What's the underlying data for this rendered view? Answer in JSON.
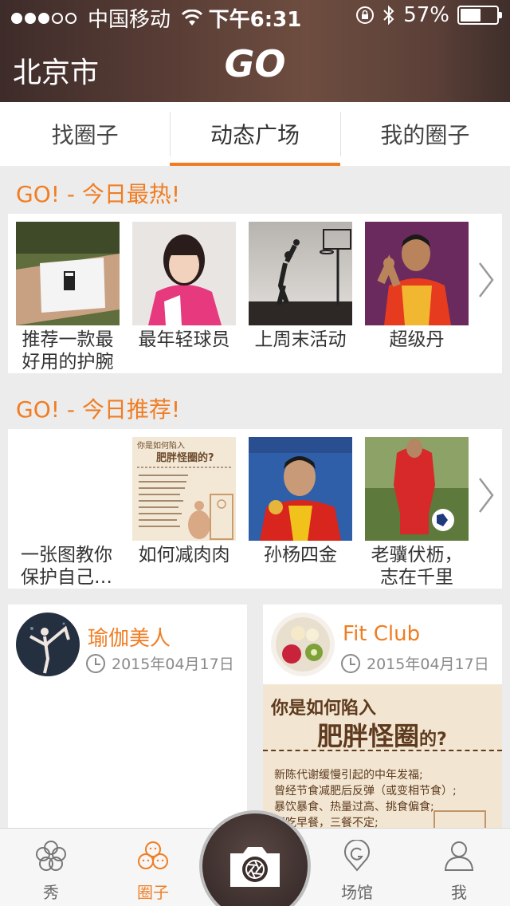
{
  "status_bar": {
    "carrier": "中国移动",
    "time": "下午6:31",
    "battery_percent": "57%",
    "battery_level": 0.57
  },
  "header": {
    "city": "北京市",
    "logo_text": "GO"
  },
  "tabs": [
    {
      "label": "找圈子",
      "active": false
    },
    {
      "label": "动态广场",
      "active": true
    },
    {
      "label": "我的圈子",
      "active": false
    }
  ],
  "hot_section": {
    "title": "GO! - 今日最热!",
    "items": [
      {
        "label": "推荐一款最好用的护腕",
        "thumb": "wristband-photo"
      },
      {
        "label": "最年轻球员",
        "thumb": "table-tennis-girl-photo"
      },
      {
        "label": "上周末活动",
        "thumb": "basketball-silhouette-photo"
      },
      {
        "label": "超级丹",
        "thumb": "badminton-player-photo"
      }
    ]
  },
  "recommend_section": {
    "title": "GO! - 今日推荐!",
    "items": [
      {
        "label": "一张图教你保护自己…",
        "thumb": "none"
      },
      {
        "label": "如何减肉肉",
        "thumb": "weight-infographic",
        "thumb_title_1": "你是如何陷入",
        "thumb_title_2": "肥胖怪圈的?"
      },
      {
        "label": "孙杨四金",
        "thumb": "swimmer-medal-photo"
      },
      {
        "label": "老骥伏枥，志在千里",
        "thumb": "football-player-photo"
      }
    ]
  },
  "feed": [
    {
      "name": "瑜伽美人",
      "date": "2015年04月17日",
      "avatar": "yoga-avatar"
    },
    {
      "name": "Fit Club",
      "date": "2015年04月17日",
      "avatar": "fruit-bowl-avatar",
      "image_title_1": "你是如何陷入",
      "image_title_2": "肥胖怪圈",
      "image_title_3": "的?",
      "image_lines": [
        "新陈代谢缓慢引起的中年发福;",
        "曾经节食减肥后反弹（或变相节食）;",
        "暴饮暴食、热量过高、挑食偏食;",
        "不吃早餐，三餐不定;"
      ]
    }
  ],
  "tabbar": [
    {
      "label": "秀",
      "icon": "clover-icon",
      "active": false
    },
    {
      "label": "圈子",
      "icon": "group-faces-icon",
      "active": true
    },
    {
      "label": "场馆",
      "icon": "location-pin-icon",
      "active": false
    },
    {
      "label": "我",
      "icon": "person-icon",
      "active": false
    }
  ],
  "camera_button": {
    "icon": "camera-shutter-icon"
  },
  "colors": {
    "accent": "#f07d23",
    "header_bg": "#5a3e36"
  }
}
